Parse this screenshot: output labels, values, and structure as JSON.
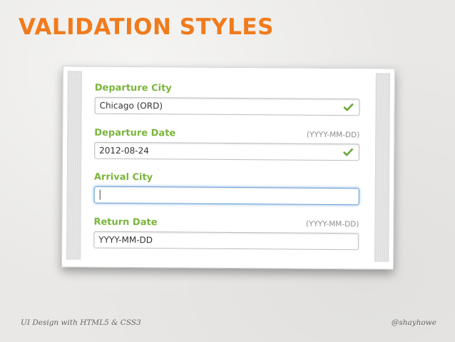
{
  "slide": {
    "title": "VALIDATION STYLES",
    "footer_left": "UI Design with HTML5 & CSS3",
    "footer_right": "@shayhowe"
  },
  "colors": {
    "title": "#f07b1d",
    "label": "#7ab53b",
    "check": "#6aa736",
    "focus_border": "#6aa2d6"
  },
  "form": {
    "fields": [
      {
        "label": "Departure City",
        "hint": "",
        "value": "Chicago (ORD)",
        "state": "valid",
        "icon": "check-icon"
      },
      {
        "label": "Departure Date",
        "hint": "(YYYY-MM-DD)",
        "value": "2012-08-24",
        "state": "valid",
        "icon": "check-icon"
      },
      {
        "label": "Arrival City",
        "hint": "",
        "value": "",
        "state": "focused"
      },
      {
        "label": "Return Date",
        "hint": "(YYYY-MM-DD)",
        "value": "YYYY-MM-DD",
        "state": "empty"
      }
    ]
  }
}
